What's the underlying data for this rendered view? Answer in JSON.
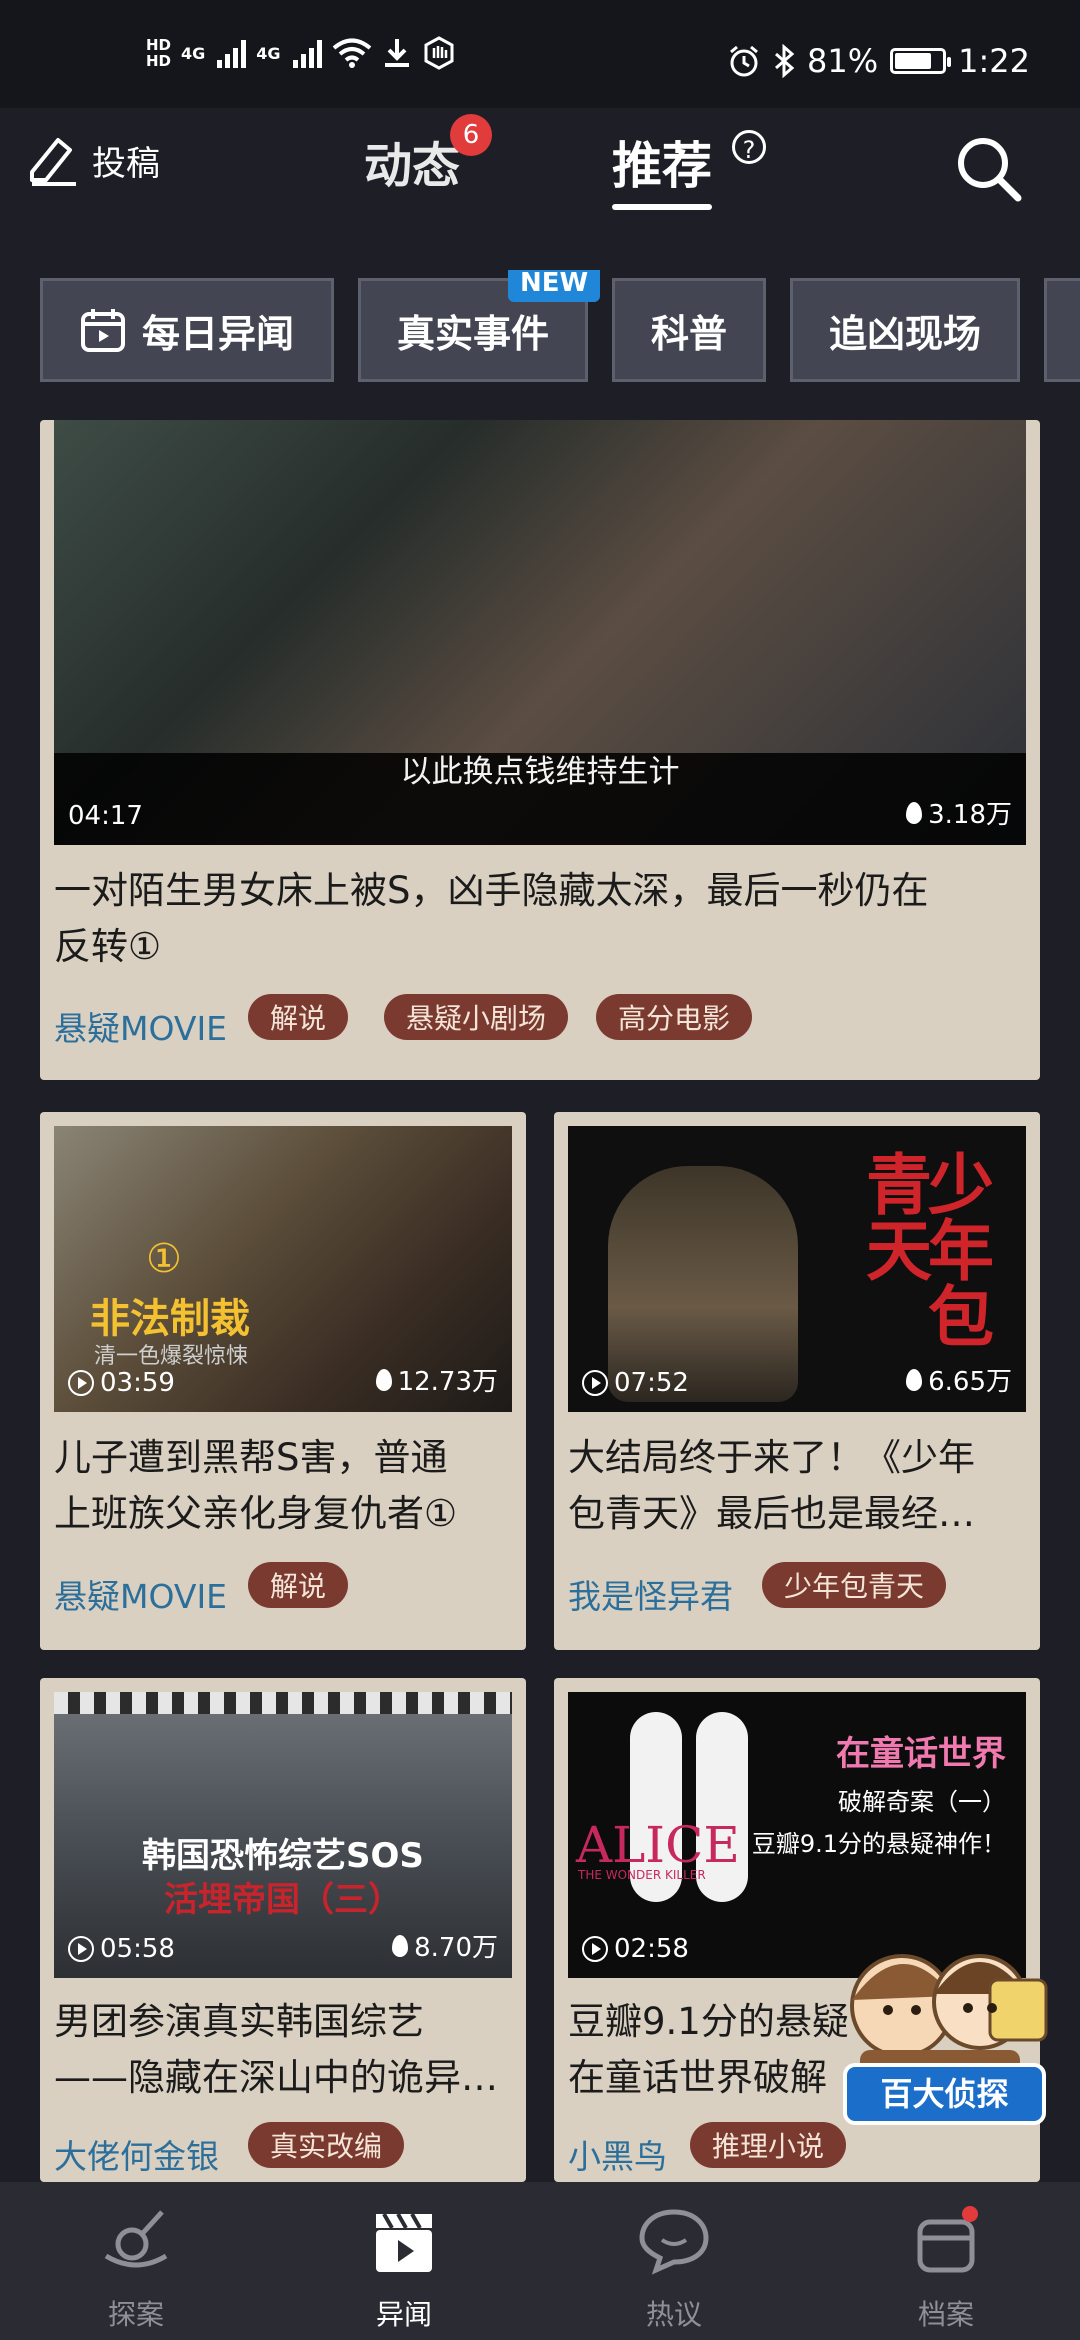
{
  "status_bar": {
    "hd1": "HD",
    "hd2": "HD",
    "net1": "4G",
    "net2": "4G",
    "battery_percent": "81%",
    "battery_level": 0.81,
    "time": "1:22"
  },
  "header": {
    "post_label": "投稿",
    "tab_dynamic": "动态",
    "dynamic_badge": "6",
    "tab_recommend": "推荐",
    "help_mark": "?"
  },
  "categories": {
    "daily": "每日异闻",
    "true_events": "真实事件",
    "new_tag": "NEW",
    "science": "科普",
    "crime_scene": "追凶现场"
  },
  "cards": [
    {
      "subtitle": "以此换点钱维持生计",
      "duration": "04:17",
      "views": "3.18万",
      "title_line1": "一对陌生男女床上被S，凶手隐藏太深，最后一秒仍在",
      "title_line2": "反转①",
      "author": "悬疑MOVIE",
      "tags": [
        "解说",
        "悬疑小剧场",
        "高分电影"
      ]
    },
    {
      "overlay_num": "①",
      "overlay_text": "非法制裁",
      "overlay_sub": "清一色爆裂惊悚",
      "duration": "03:59",
      "views": "12.73万",
      "title_line1": "儿子遭到黑帮S害，普通",
      "title_line2": "上班族父亲化身复仇者①",
      "author": "悬疑MOVIE",
      "tags": [
        "解说"
      ]
    },
    {
      "overlay_text": "少年包青天",
      "duration": "07:52",
      "views": "6.65万",
      "title_line1": "大结局终于来了！《少年",
      "title_line2": "包青天》最后也是最经…",
      "author": "我是怪异君",
      "tags": [
        "少年包青天"
      ]
    },
    {
      "overlay_line1": "韩国恐怖综艺SOS",
      "overlay_line2": "活埋帝国（三）",
      "duration": "05:58",
      "views": "8.70万",
      "title_line1": "男团参演真实韩国综艺",
      "title_line2": "——隐藏在深山中的诡异…",
      "author": "大佬何金银",
      "tags": [
        "真实改编"
      ]
    },
    {
      "overlay_alice": "ALICE",
      "overlay_alice_sub": "THE WONDER KILLER",
      "overlay_line1": "在童话世界",
      "overlay_line2": "破解奇案（一）",
      "overlay_line3": "豆瓣9.1分的悬疑神作！",
      "duration": "02:58",
      "title_line1": "豆瓣9.1分的悬疑",
      "title_line2": "在童话世界破解",
      "author": "小黑鸟",
      "tags": [
        "推理小说"
      ]
    }
  ],
  "mascot": {
    "label": "百大侦探"
  },
  "bottom_nav": [
    {
      "label": "探案",
      "icon": "compass-icon"
    },
    {
      "label": "异闻",
      "icon": "clapperboard-icon"
    },
    {
      "label": "热议",
      "icon": "chat-icon"
    },
    {
      "label": "档案",
      "icon": "profile-icon"
    }
  ]
}
